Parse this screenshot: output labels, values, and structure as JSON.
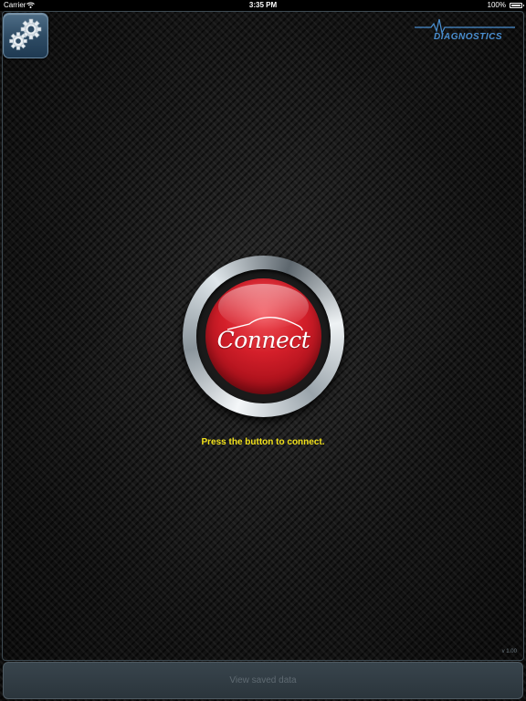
{
  "status_bar": {
    "carrier": "Carrier",
    "wifi_icon": "wifi-icon",
    "time": "3:35 PM",
    "battery_percent": "100%",
    "battery_icon": "battery-icon"
  },
  "header": {
    "settings_icon": "gear-icon",
    "logo_icon": "ecg-waveform-icon",
    "logo_text": "DIAGNOSTICS"
  },
  "main": {
    "connect_button_label": "Connect",
    "connect_button_icon": "car-silhouette-icon",
    "prompt": "Press the button to connect."
  },
  "footer": {
    "version": "v 1.00",
    "view_saved_label": "View saved data"
  },
  "colors": {
    "prompt": "#f3e21b",
    "brand_blue": "#4a8fd1",
    "connect_red": "#d41f2a"
  }
}
